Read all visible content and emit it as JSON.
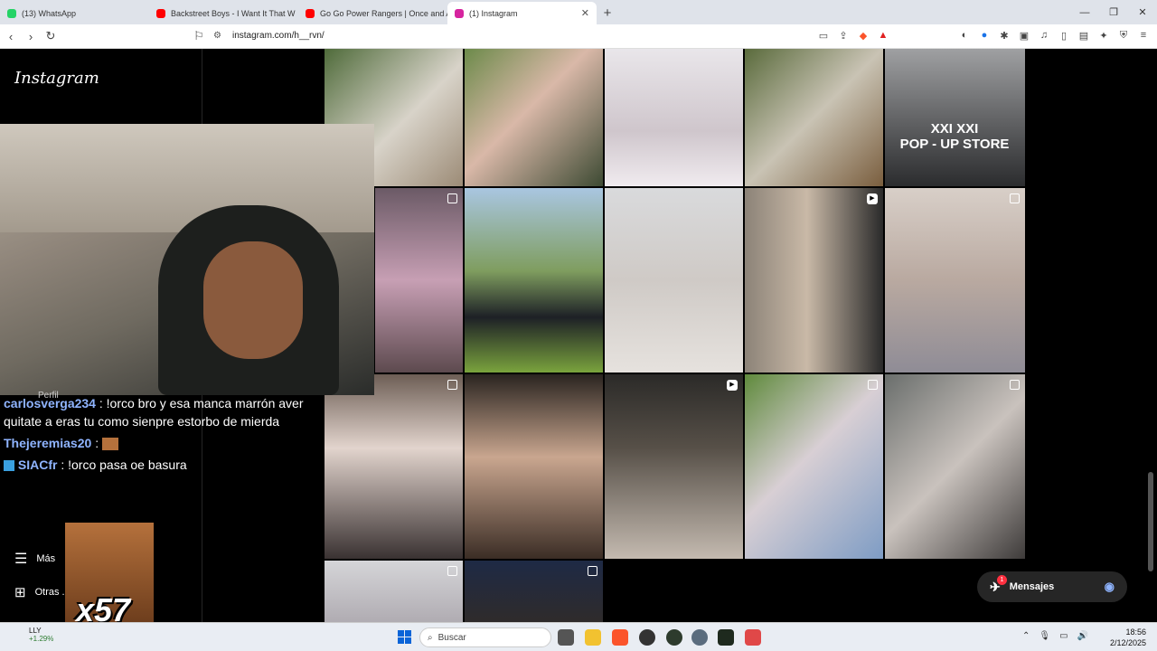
{
  "browser": {
    "tabs": [
      {
        "title": "(13) WhatsApp",
        "color": "#25d366"
      },
      {
        "title": "Backstreet Boys - I Want It That W",
        "color": "#ff0000"
      },
      {
        "title": "Go Go Power Rangers | Once and Alw",
        "color": "#ff0000"
      },
      {
        "title": "(1) Instagram",
        "color": "#d6249f",
        "active": true
      }
    ],
    "url": "instagram.com/h__rvn/"
  },
  "instagram": {
    "logo": "Instagram",
    "sidebar": {
      "profile_label": "Perfil",
      "more_label": "Más",
      "other_label": "Otras ..."
    },
    "popup_tile": {
      "line1": "XXI XXI",
      "line2": "POP - UP STORE"
    },
    "messages_label": "Mensajes",
    "messages_badge": "1"
  },
  "stream": {
    "chat": [
      {
        "user": "carlosverga234",
        "text": ": !orco bro y esa manca marrón aver quitate a eras tu como sienpre estorbo de mierda"
      },
      {
        "user": "Thejeremias20",
        "text": ": "
      },
      {
        "user": "SIACfr",
        "text": ": !orco pasa oe basura"
      }
    ],
    "emote_counter": "x57"
  },
  "taskbar": {
    "weather_label": "LLY",
    "weather_change": "+1.29%",
    "search_placeholder": "Buscar",
    "time": "18:56",
    "date": "2/12/2025"
  }
}
